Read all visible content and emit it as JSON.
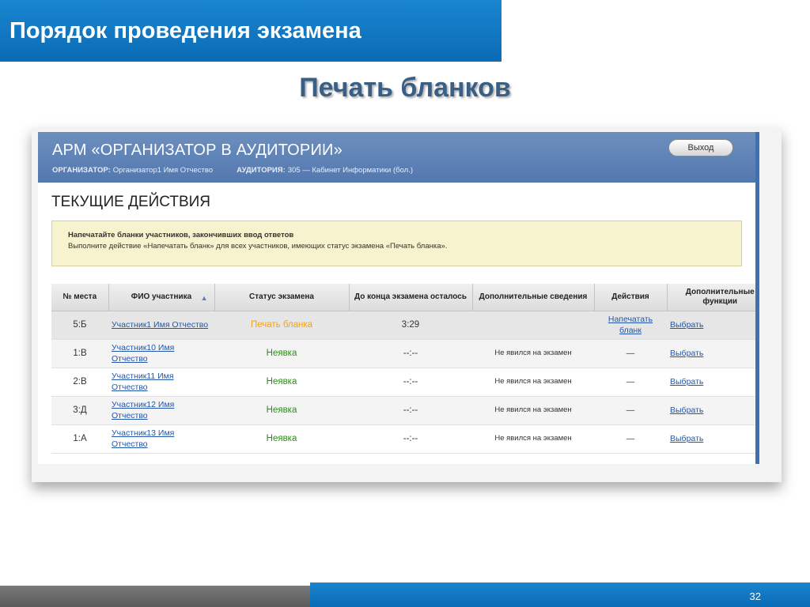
{
  "slide": {
    "title": "Порядок проведения экзамена",
    "subtitle": "Печать бланков",
    "page_number": "32"
  },
  "app": {
    "title": "АРМ «ОРГАНИЗАТОР В АУДИТОРИИ»",
    "exit_label": "Выход",
    "organizer_label": "Организатор:",
    "organizer_value": "Организатор1 Имя Отчество",
    "room_label": "Аудитория:",
    "room_value": "305 — Кабинет Информатики (бол.)",
    "section_title": "ТЕКУЩИЕ ДЕЙСТВИЯ",
    "notice": {
      "title": "Напечатайте бланки участников, закончивших ввод ответов",
      "text": "Выполните действие «Напечатать бланк» для всех участников, имеющих статус экзамена «Печать бланка»."
    },
    "table": {
      "headers": {
        "place": "№ места",
        "name": "ФИО участника",
        "status": "Статус экзамена",
        "remaining": "До конца экзамена осталось",
        "info": "Дополнительные сведения",
        "actions": "Действия",
        "extra": "Дополнительные функции"
      },
      "rows": [
        {
          "place": "5:Б",
          "name": "Участник1 Имя Отчество",
          "status": "Печать бланка",
          "remaining": "3:29",
          "info": "",
          "action": "Напечатать бланк",
          "extra": "Выбрать"
        },
        {
          "place": "1:В",
          "name": "Участник10 Имя Отчество",
          "status": "Неявка",
          "remaining": "--:--",
          "info": "Не явился на экзамен",
          "action": "—",
          "extra": "Выбрать"
        },
        {
          "place": "2:В",
          "name": "Участник11 Имя Отчество",
          "status": "Неявка",
          "remaining": "--:--",
          "info": "Не явился на экзамен",
          "action": "—",
          "extra": "Выбрать"
        },
        {
          "place": "3:Д",
          "name": "Участник12 Имя Отчество",
          "status": "Неявка",
          "remaining": "--:--",
          "info": "Не явился на экзамен",
          "action": "—",
          "extra": "Выбрать"
        },
        {
          "place": "1:А",
          "name": "Участник13 Имя Отчество",
          "status": "Неявка",
          "remaining": "--:--",
          "info": "Не явился на экзамен",
          "action": "—",
          "extra": "Выбрать"
        }
      ]
    }
  },
  "colors": {
    "slide_blue": "#0a6bb6",
    "header_blue": "#5b7fb3",
    "status_print": "#f0a31a",
    "status_absent": "#2f8a1e",
    "link": "#2356a8"
  }
}
